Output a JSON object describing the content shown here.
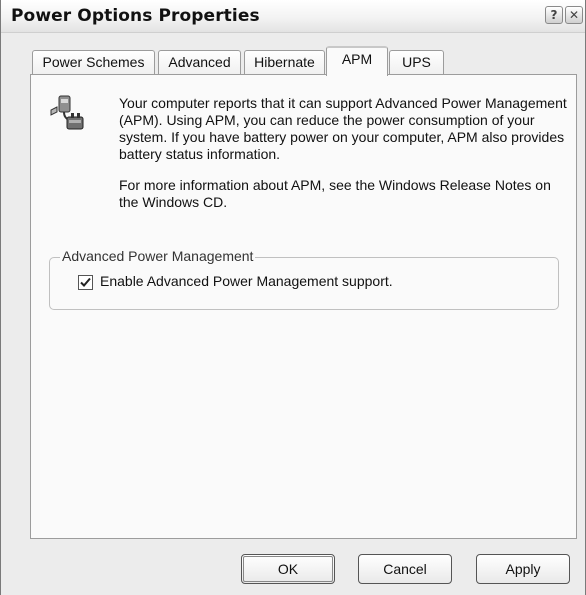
{
  "window": {
    "title": "Power Options Properties",
    "help_glyph": "?",
    "close_glyph": "✕"
  },
  "tabs": [
    {
      "label": "Power Schemes",
      "active": false
    },
    {
      "label": "Advanced",
      "active": false
    },
    {
      "label": "Hibernate",
      "active": false
    },
    {
      "label": "APM",
      "active": true
    },
    {
      "label": "UPS",
      "active": false
    }
  ],
  "apm": {
    "icon": "apm-plug-icon",
    "paragraph1": "Your computer reports that it can support Advanced Power Management (APM).  Using APM, you can reduce the power consumption of your system.  If you have battery power on your computer, APM also provides battery status information.",
    "paragraph2": "For more information about APM, see the Windows Release Notes on the Windows CD.",
    "group_label": "Advanced Power Management",
    "checkbox_label": "Enable Advanced Power Management support.",
    "checkbox_checked": true
  },
  "buttons": {
    "ok": "OK",
    "cancel": "Cancel",
    "apply": "Apply"
  }
}
